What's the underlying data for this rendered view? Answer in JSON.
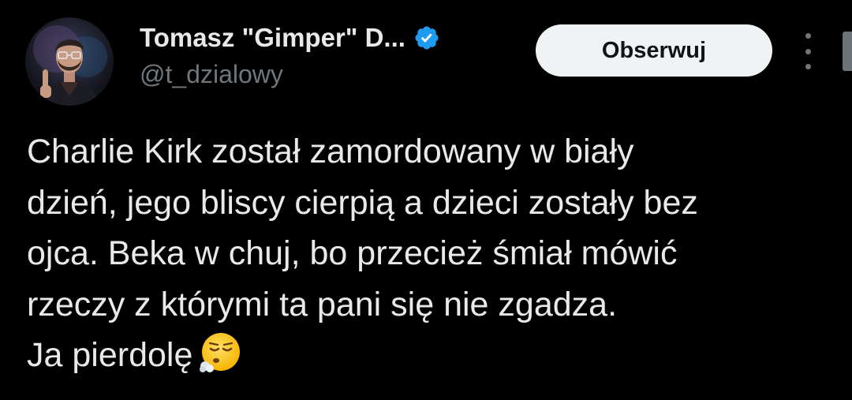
{
  "author": {
    "display_name": "Tomasz \"Gimper\" D...",
    "handle": "@t_dzialowy",
    "verified_icon": "verified-badge-icon",
    "verified_color": "#1d9bf0"
  },
  "actions": {
    "follow_label": "Obserwuj",
    "more_icon": "more-vertical-icon"
  },
  "tweet": {
    "lines": [
      "Charlie Kirk został zamordowany w biały",
      "dzień, jego bliscy cierpią a dzieci zostały bez",
      "ojca. Beka w chuj, bo przecież śmiał mówić",
      "rzeczy z którymi ta pani się nie zgadza.",
      "Ja pierdolę"
    ],
    "emoji": "face-exhaling-emoji"
  },
  "colors": {
    "background": "#000000",
    "text": "#e7e9ea",
    "secondary_text": "#71767b",
    "button_bg": "#eff3f4",
    "button_text": "#0f1419"
  }
}
